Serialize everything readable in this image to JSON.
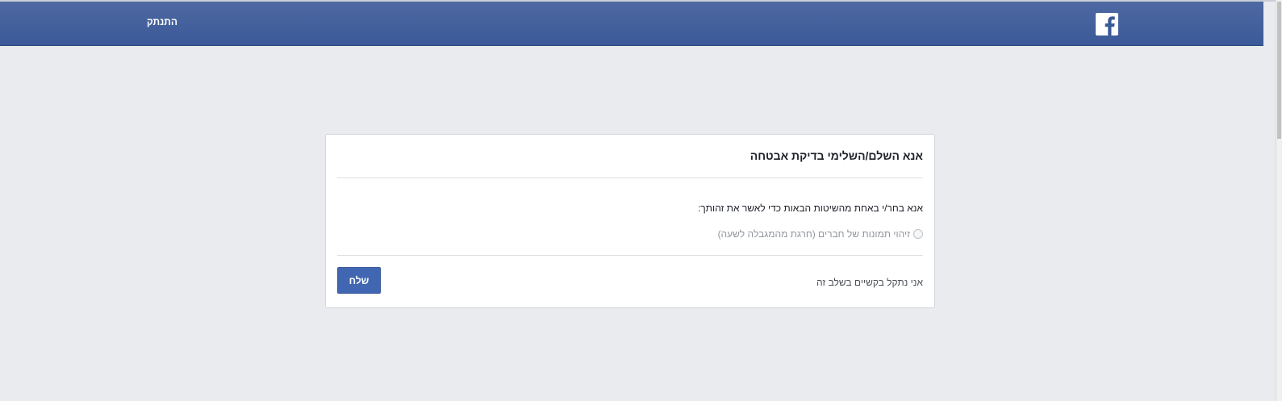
{
  "header": {
    "logout_label": "התנתק",
    "logo_icon": "facebook-logo-icon",
    "brand_color": "#3b5998"
  },
  "card": {
    "title": "אנא השלם/השלימי בדיקת אבטחה",
    "instruction": "אנא בחר/י באחת מהשיטות הבאות כדי לאשר את זהותך:",
    "options": [
      {
        "label": "זיהוי תמונות של חברים (חרגת מהמגבלה לשעה)",
        "selected": false,
        "disabled": true
      }
    ],
    "trouble_link": "אני נתקל בקשיים בשלב זה",
    "submit_label": "שלח"
  },
  "colors": {
    "page_background": "#e9ebee",
    "button": "#4267b2"
  }
}
